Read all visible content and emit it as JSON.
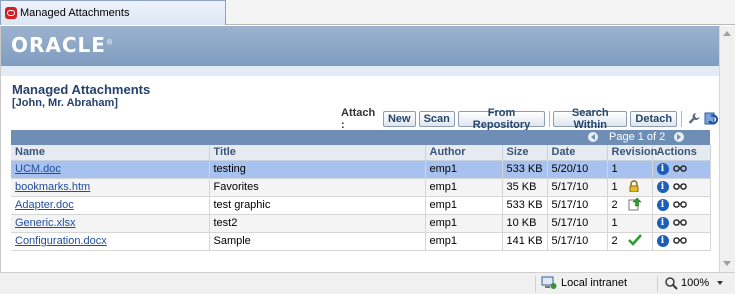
{
  "browser": {
    "tab_title": "Managed Attachments"
  },
  "brand": {
    "logo_text": "ORACLE",
    "logo_mark": "®"
  },
  "page": {
    "title": "Managed Attachments",
    "subtitle": "[John, Mr. Abraham]"
  },
  "toolbar": {
    "attach_label": "Attach :",
    "buttons": [
      "New",
      "Scan",
      "From Repository",
      "Search Within",
      "Detach"
    ],
    "icons": [
      "wrench-icon",
      "refresh-icon"
    ]
  },
  "pager": {
    "text": "Page 1 of 2"
  },
  "table": {
    "columns": [
      "Name",
      "Title",
      "Author",
      "Size",
      "Date",
      "Revision",
      "Actions"
    ],
    "rows": [
      {
        "name": "UCM.doc",
        "title": "testing",
        "author": "emp1",
        "size": "533 KB",
        "date": "5/20/10",
        "revision": "1",
        "status_icon": "",
        "selected": true
      },
      {
        "name": "bookmarks.htm",
        "title": "Favorites",
        "author": "emp1",
        "size": "35 KB",
        "date": "5/17/10",
        "revision": "1",
        "status_icon": "lock-icon",
        "selected": false
      },
      {
        "name": "Adapter.doc",
        "title": "test graphic",
        "author": "emp1",
        "size": "533 KB",
        "date": "5/17/10",
        "revision": "2",
        "status_icon": "upload-icon",
        "selected": false
      },
      {
        "name": "Generic.xlsx",
        "title": "test2",
        "author": "emp1",
        "size": "10 KB",
        "date": "5/17/10",
        "revision": "1",
        "status_icon": "",
        "selected": false
      },
      {
        "name": "Configuration.docx",
        "title": "Sample",
        "author": "emp1",
        "size": "141 KB",
        "date": "5/17/10",
        "revision": "2",
        "status_icon": "checkmark-icon",
        "selected": false
      }
    ],
    "action_icons": [
      "info-icon",
      "glasses-icon"
    ]
  },
  "statusbar": {
    "zone": "Local intranet",
    "zoom": "100%"
  },
  "colors": {
    "brand_bar": "#7f9cbf",
    "title_text": "#25416c",
    "pager_bar": "#6f8eb6",
    "selected_row": "#a8c2ef",
    "link": "#1f4d9c"
  }
}
